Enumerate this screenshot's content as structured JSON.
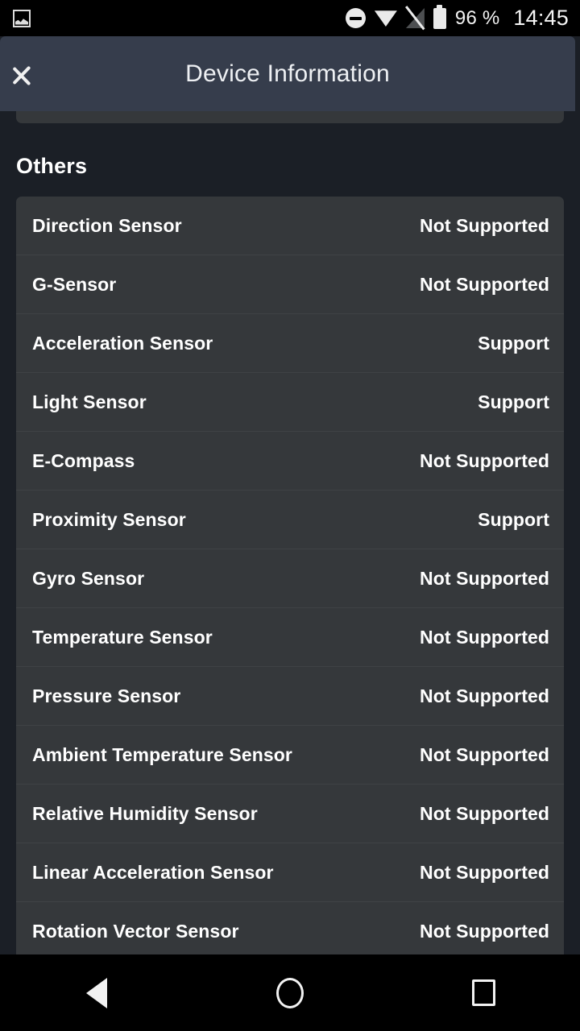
{
  "status_bar": {
    "notification_icon": "screenshot-icon",
    "icons": [
      "do-not-disturb-icon",
      "wifi-icon",
      "signal-off-icon",
      "battery-icon"
    ],
    "battery_percent": "96 %",
    "clock": "14:45"
  },
  "app_bar": {
    "back_icon": "chevron-left-icon",
    "title": "Device Information"
  },
  "content": {
    "section_title": "Others",
    "rows": [
      {
        "label": "Direction Sensor",
        "value": "Not Supported"
      },
      {
        "label": "G-Sensor",
        "value": "Not Supported"
      },
      {
        "label": "Acceleration Sensor",
        "value": "Support"
      },
      {
        "label": "Light Sensor",
        "value": "Support"
      },
      {
        "label": "E-Compass",
        "value": "Not Supported"
      },
      {
        "label": "Proximity Sensor",
        "value": "Support"
      },
      {
        "label": "Gyro Sensor",
        "value": "Not Supported"
      },
      {
        "label": "Temperature Sensor",
        "value": "Not Supported"
      },
      {
        "label": "Pressure Sensor",
        "value": "Not Supported"
      },
      {
        "label": "Ambient Temperature Sensor",
        "value": "Not Supported"
      },
      {
        "label": "Relative Humidity Sensor",
        "value": "Not Supported"
      },
      {
        "label": "Linear Acceleration Sensor",
        "value": "Not Supported"
      },
      {
        "label": "Rotation Vector Sensor",
        "value": "Not Supported"
      }
    ]
  },
  "nav_bar": {
    "back": "back-triangle-icon",
    "home": "home-circle-icon",
    "recents": "recents-square-icon"
  },
  "colors": {
    "page_background": "#1b1f26",
    "app_bar": "#363d4c",
    "card": "#35383b",
    "row_divider": "#3f4245",
    "text_primary": "#ffffff",
    "status_bar": "#000000"
  }
}
